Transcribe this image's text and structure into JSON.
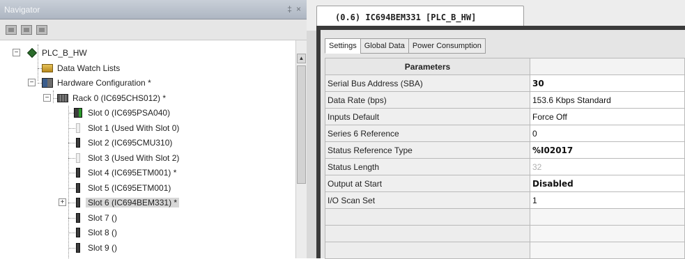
{
  "navigator": {
    "title": "Navigator",
    "pin_glyph": "‡",
    "close_glyph": "×",
    "toolbar_icons": [
      "tree-view-icon",
      "filter-icon",
      "options-icon"
    ],
    "tree": [
      {
        "label": "PLC_B_HW",
        "icon": "plc-diamond-icon",
        "expander": "−"
      },
      {
        "label": "Data Watch Lists",
        "icon": "data-watch-icon"
      },
      {
        "label": "Hardware Configuration *",
        "icon": "hardware-config-icon",
        "expander": "−"
      },
      {
        "label": "Rack 0 (IC695CHS012) *",
        "icon": "rack-icon",
        "expander": "−"
      },
      {
        "label": "Slot 0 (IC695PSA040)",
        "icon": "power-supply-icon"
      },
      {
        "label": "Slot 1 (Used With Slot 0)",
        "icon": "empty-slot-icon"
      },
      {
        "label": "Slot 2 (IC695CMU310)",
        "icon": "module-icon"
      },
      {
        "label": "Slot 3 (Used With Slot 2)",
        "icon": "empty-slot-icon"
      },
      {
        "label": "Slot 4 (IC695ETM001) *",
        "icon": "module-icon"
      },
      {
        "label": "Slot 5 (IC695ETM001)",
        "icon": "module-icon"
      },
      {
        "label": "Slot 6 (IC694BEM331) *",
        "icon": "module-icon",
        "expander": "+",
        "selected": true
      },
      {
        "label": "Slot 7 ()",
        "icon": "module-icon"
      },
      {
        "label": "Slot 8 ()",
        "icon": "module-icon"
      },
      {
        "label": "Slot 9 ()",
        "icon": "module-icon"
      }
    ]
  },
  "editor": {
    "doc_tab": "(0.6) IC694BEM331 [PLC_B_HW]",
    "sub_tabs": [
      "Settings",
      "Global Data",
      "Power Consumption"
    ],
    "active_sub_tab": "Settings",
    "grid": {
      "header": "Parameters",
      "rows": [
        {
          "name": "Serial Bus Address (SBA)",
          "value": "30",
          "style": "bold"
        },
        {
          "name": "Data Rate (bps)",
          "value": "153.6 Kbps Standard",
          "style": ""
        },
        {
          "name": "Inputs Default",
          "value": "Force Off",
          "style": ""
        },
        {
          "name": "Series 6 Reference",
          "value": "0",
          "style": ""
        },
        {
          "name": "Status Reference Type",
          "value": "%I02017",
          "style": "bold"
        },
        {
          "name": "Status Length",
          "value": "32",
          "style": "muted"
        },
        {
          "name": "Output at Start",
          "value": "Disabled",
          "style": "bold"
        },
        {
          "name": "I/O Scan Set",
          "value": "1",
          "style": ""
        }
      ],
      "empty_rows": 3
    }
  }
}
